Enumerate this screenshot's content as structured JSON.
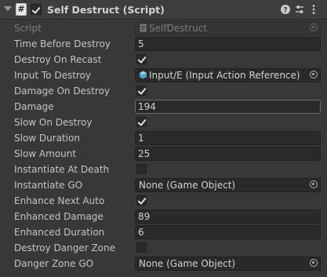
{
  "component": {
    "title": "Self Destruct (Script)",
    "enabled": true
  },
  "header_icons": [
    "help-icon",
    "presets-icon",
    "more-icon"
  ],
  "fields": [
    {
      "label": "Script",
      "type": "object",
      "value": "SelfDestruct",
      "icon": "script-file-icon",
      "disabled": true
    },
    {
      "label": "Time Before Destroy",
      "type": "number",
      "value": "5"
    },
    {
      "label": "Destroy On Recast",
      "type": "toggle",
      "checked": true
    },
    {
      "label": "Input To Destroy",
      "type": "object",
      "value": "Input/E (Input Action Reference)",
      "icon": "input-action-icon"
    },
    {
      "label": "Damage On Destroy",
      "type": "toggle",
      "checked": true
    },
    {
      "label": "Damage",
      "type": "number",
      "value": "194",
      "active": true
    },
    {
      "label": "Slow On Destroy",
      "type": "toggle",
      "checked": true
    },
    {
      "label": "Slow Duration",
      "type": "number",
      "value": "1"
    },
    {
      "label": "Slow Amount",
      "type": "number",
      "value": "25"
    },
    {
      "label": "Instantiate At Death",
      "type": "toggle",
      "checked": false
    },
    {
      "label": "Instantiate GO",
      "type": "object",
      "value": "None (Game Object)"
    },
    {
      "label": "Enhance Next Auto",
      "type": "toggle",
      "checked": true
    },
    {
      "label": "Enhanced Damage",
      "type": "number",
      "value": "89"
    },
    {
      "label": "Enhanced Duration",
      "type": "number",
      "value": "6"
    },
    {
      "label": "Destroy Danger Zone",
      "type": "toggle",
      "checked": false
    },
    {
      "label": "Danger Zone GO",
      "type": "object",
      "value": "None (Game Object)"
    }
  ]
}
